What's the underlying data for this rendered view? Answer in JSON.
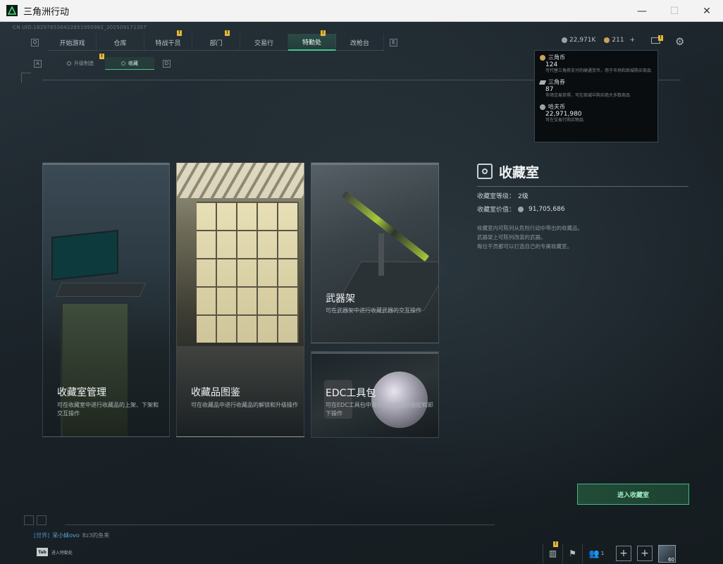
{
  "window": {
    "title": "三角洲行动",
    "minimize": "—",
    "maximize": "☐",
    "close": "✕"
  },
  "uid": "CN UID:182976530422851950982_202509171357",
  "topnav": {
    "key_left": "Q",
    "key_right": "E",
    "tabs": [
      {
        "label": "开始游戏",
        "badge": ""
      },
      {
        "label": "仓库",
        "badge": ""
      },
      {
        "label": "特战干员",
        "badge": "!"
      },
      {
        "label": "部门",
        "badge": "!"
      },
      {
        "label": "交易行",
        "badge": ""
      },
      {
        "label": "特勤处",
        "badge": "!",
        "active": true
      },
      {
        "label": "改枪台",
        "badge": ""
      }
    ]
  },
  "currency_bar": {
    "hafu": "22,971K",
    "coupon": "211",
    "plus": "+",
    "mail_badge": "!"
  },
  "subnav": {
    "key_left": "A",
    "key_right": "D",
    "tabs": [
      {
        "label": "升级制造",
        "badge": "!"
      },
      {
        "label": "收藏",
        "active": true
      }
    ]
  },
  "popup": {
    "items": [
      {
        "name": "三角币",
        "value": "124",
        "desc": "可代替三角券支付的硬通货币，用于市场和商城购买商品"
      },
      {
        "name": "三角券",
        "value": "87",
        "desc": "市场交易获得，可在商城中购买绝大多数商品"
      },
      {
        "name": "哈夫币",
        "value": "22,971,980",
        "desc": "可在交易行购买物品"
      }
    ]
  },
  "cards": {
    "mgmt": {
      "title": "收藏室管理",
      "desc": "可在收藏室中进行收藏品的上架、下架和交互操作"
    },
    "catalog": {
      "title": "收藏品图鉴",
      "desc": "可在收藏品中进行收藏品的解锁和升级操作"
    },
    "rack": {
      "title": "武器架",
      "desc": "可在武器架中进行收藏武器的交互操作"
    },
    "edc": {
      "title": "EDC工具包",
      "desc": "可在EDC工具包中进行随身物品的装配和卸下操作"
    }
  },
  "info": {
    "title": "收藏室",
    "level_label": "收藏室等级：",
    "level_value": "2级",
    "value_label": "收藏室价值：",
    "value_value": "91,705,686",
    "desc_lines": [
      "收藏室内可陈列从危险行动中带出的收藏品。",
      "武器架上可陈列改装的武器。",
      "每位干员都可以打造自己的专属收藏室。"
    ]
  },
  "enter_button": "进入收藏室",
  "chat": {
    "channel": "[世界]",
    "user": "呆小妹ovo",
    "message": "8z3的鱼来"
  },
  "tab_hint": {
    "key": "Tab",
    "label": "进入特勤处"
  },
  "bottom_bar": {
    "stats_badge": "!",
    "friends_count": "1",
    "plus1": "+",
    "plus2": "+",
    "avatar_level": "60"
  },
  "colors": {
    "accent": "#45c48b",
    "badge": "#e8b638"
  }
}
